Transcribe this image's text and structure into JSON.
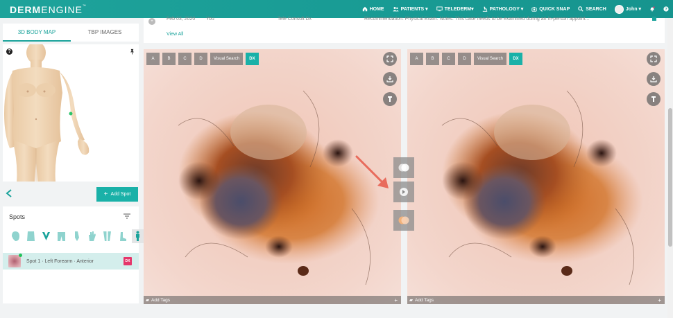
{
  "app": {
    "logo_bold": "DERM",
    "logo_light": "ENGINE",
    "logo_tm": "™"
  },
  "nav": {
    "items": [
      {
        "label": "HOME",
        "icon": "home-icon"
      },
      {
        "label": "PATIENTS ▾",
        "icon": "users-icon"
      },
      {
        "label": "TELEDERM▾",
        "icon": "telederm-icon"
      },
      {
        "label": "PATHOLOGY ▾",
        "icon": "microscope-icon"
      },
      {
        "label": "QUICK SNAP",
        "icon": "camera-icon"
      },
      {
        "label": "SEARCH",
        "icon": "search-icon"
      }
    ],
    "user_name": "John ▾"
  },
  "left": {
    "tabs": [
      {
        "label": "3D BODY MAP"
      },
      {
        "label": "TBP IMAGES"
      }
    ],
    "add_spot_label": "Add Spot",
    "spots_title": "Spots",
    "spot": {
      "label": "Spot 1 · Left Forearm · Anterior",
      "badge": "DX"
    }
  },
  "history": {
    "date": "Feb 03, 2020",
    "author": "You",
    "type": "Tele Consult Dx",
    "note": "Recommendation: Physical Exam. Notes: This case needs to be examined during an in-person appoint...",
    "view_all": "View All"
  },
  "panel_tools": {
    "a": "A",
    "b": "B",
    "c": "C",
    "d": "D",
    "visual_search": "Visual Search",
    "dx": "DX"
  },
  "add_tags_label": "Add Tags",
  "colors": {
    "accent": "#1aa39b",
    "dx_badge": "#e5366a",
    "arrow": "#e86b5c"
  }
}
